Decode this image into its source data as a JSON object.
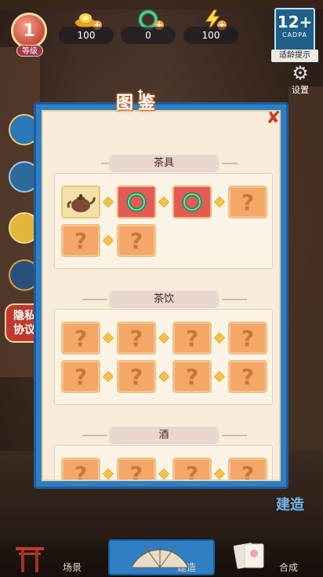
{
  "hud": {
    "level": "1",
    "level_label": "等级",
    "resources": [
      {
        "icon": "gold-ingot-icon",
        "value": "100"
      },
      {
        "icon": "jade-ring-icon",
        "value": "0"
      },
      {
        "icon": "lightning-energy-icon",
        "value": "100"
      }
    ],
    "age_rating": {
      "age": "12+",
      "org": "CADPA",
      "label": "适龄提示"
    },
    "settings_label": "设置"
  },
  "side": {
    "privacy_label": "隐私协议"
  },
  "modal": {
    "title": "图鉴",
    "sections": [
      {
        "name": "茶具",
        "rows": [
          [
            {
              "type": "teapot"
            },
            {
              "type": "jade"
            },
            {
              "type": "jade"
            },
            {
              "type": "unknown"
            }
          ],
          [
            {
              "type": "unknown"
            },
            {
              "type": "unknown"
            }
          ]
        ]
      },
      {
        "name": "茶饮",
        "rows": [
          [
            {
              "type": "unknown"
            },
            {
              "type": "unknown"
            },
            {
              "type": "unknown"
            },
            {
              "type": "unknown"
            }
          ],
          [
            {
              "type": "unknown"
            },
            {
              "type": "unknown"
            },
            {
              "type": "unknown"
            },
            {
              "type": "unknown"
            }
          ]
        ]
      },
      {
        "name": "酒",
        "rows": [
          [
            {
              "type": "unknown"
            },
            {
              "type": "unknown"
            },
            {
              "type": "unknown"
            },
            {
              "type": "unknown"
            }
          ]
        ]
      }
    ],
    "unknown_glyph": "?"
  },
  "nav": {
    "items": [
      "场景",
      "建造",
      "合成"
    ],
    "active": "建造",
    "build_float_label": "建造"
  }
}
